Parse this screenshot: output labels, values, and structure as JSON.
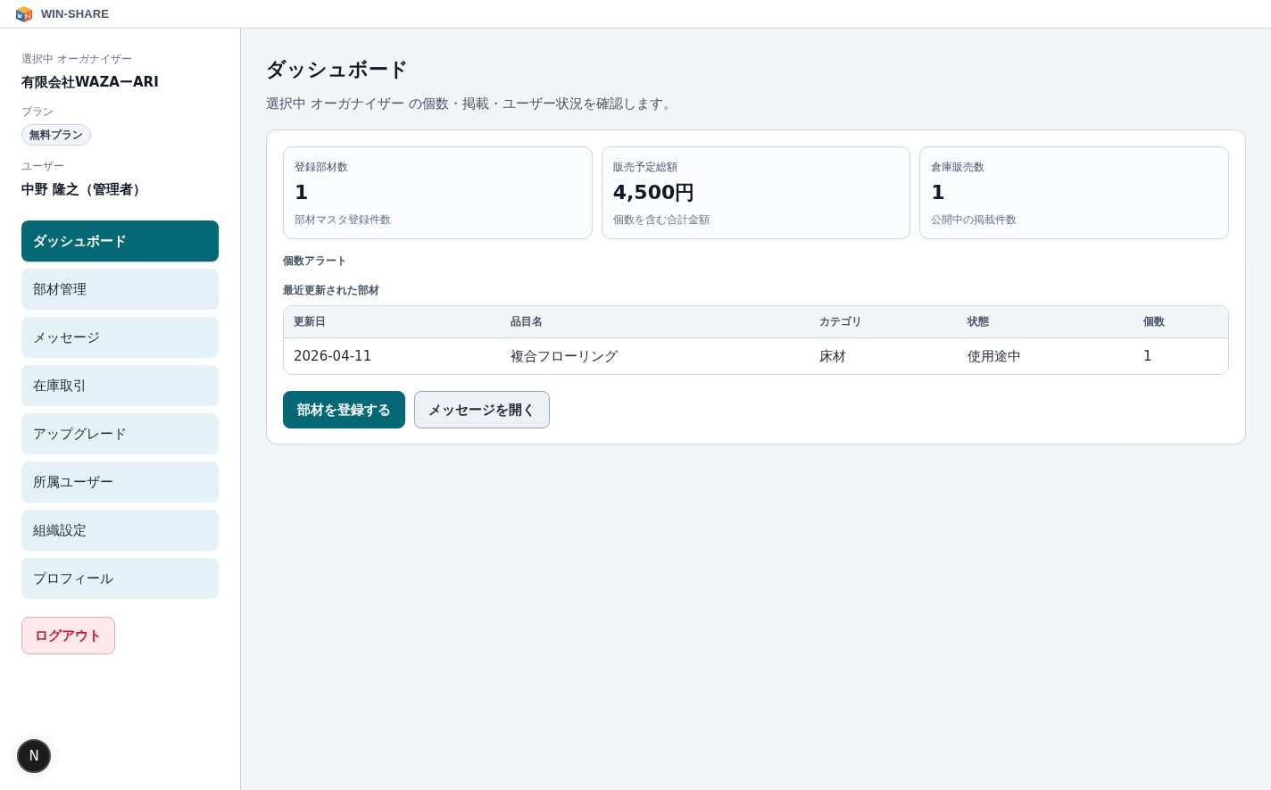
{
  "app": {
    "name": "WIN-SHARE"
  },
  "sidebar": {
    "organizer_label": "選択中 オーガナイザー",
    "organizer": "有限会社WAZAーARI",
    "plan_label": "プラン",
    "plan": "無料プラン",
    "user_label": "ユーザー",
    "user": "中野 隆之（管理者）",
    "nav": [
      {
        "label": "ダッシュボード",
        "selected": true
      },
      {
        "label": "部材管理",
        "selected": false
      },
      {
        "label": "メッセージ",
        "selected": false
      },
      {
        "label": "在庫取引",
        "selected": false
      },
      {
        "label": "アップグレード",
        "selected": false
      },
      {
        "label": "所属ユーザー",
        "selected": false
      },
      {
        "label": "組織設定",
        "selected": false
      },
      {
        "label": "プロフィール",
        "selected": false
      }
    ],
    "logout": "ログアウト"
  },
  "page": {
    "title": "ダッシュボード",
    "subtitle": "選択中 オーガナイザー の個数・掲載・ユーザー状況を確認します。"
  },
  "stats": [
    {
      "label": "登録部材数",
      "value": "1",
      "note": "部材マスタ登録件数"
    },
    {
      "label": "販売予定総額",
      "value": "4,500円",
      "note": "個数を含む合計金額"
    },
    {
      "label": "倉庫販売数",
      "value": "1",
      "note": "公開中の掲載件数"
    }
  ],
  "alerts": {
    "heading": "個数アラート"
  },
  "recent": {
    "heading": "最近更新された部材",
    "columns": [
      "更新日",
      "品目名",
      "カテゴリ",
      "状態",
      "個数"
    ],
    "rows": [
      [
        "2026-04-11",
        "複合フローリング",
        "床材",
        "使用途中",
        "1"
      ]
    ]
  },
  "actions": [
    {
      "label": "部材を登録する",
      "kind": "primary"
    },
    {
      "label": "メッセージを開く",
      "kind": "secondary"
    }
  ],
  "dev_badge": {
    "label": "N"
  }
}
